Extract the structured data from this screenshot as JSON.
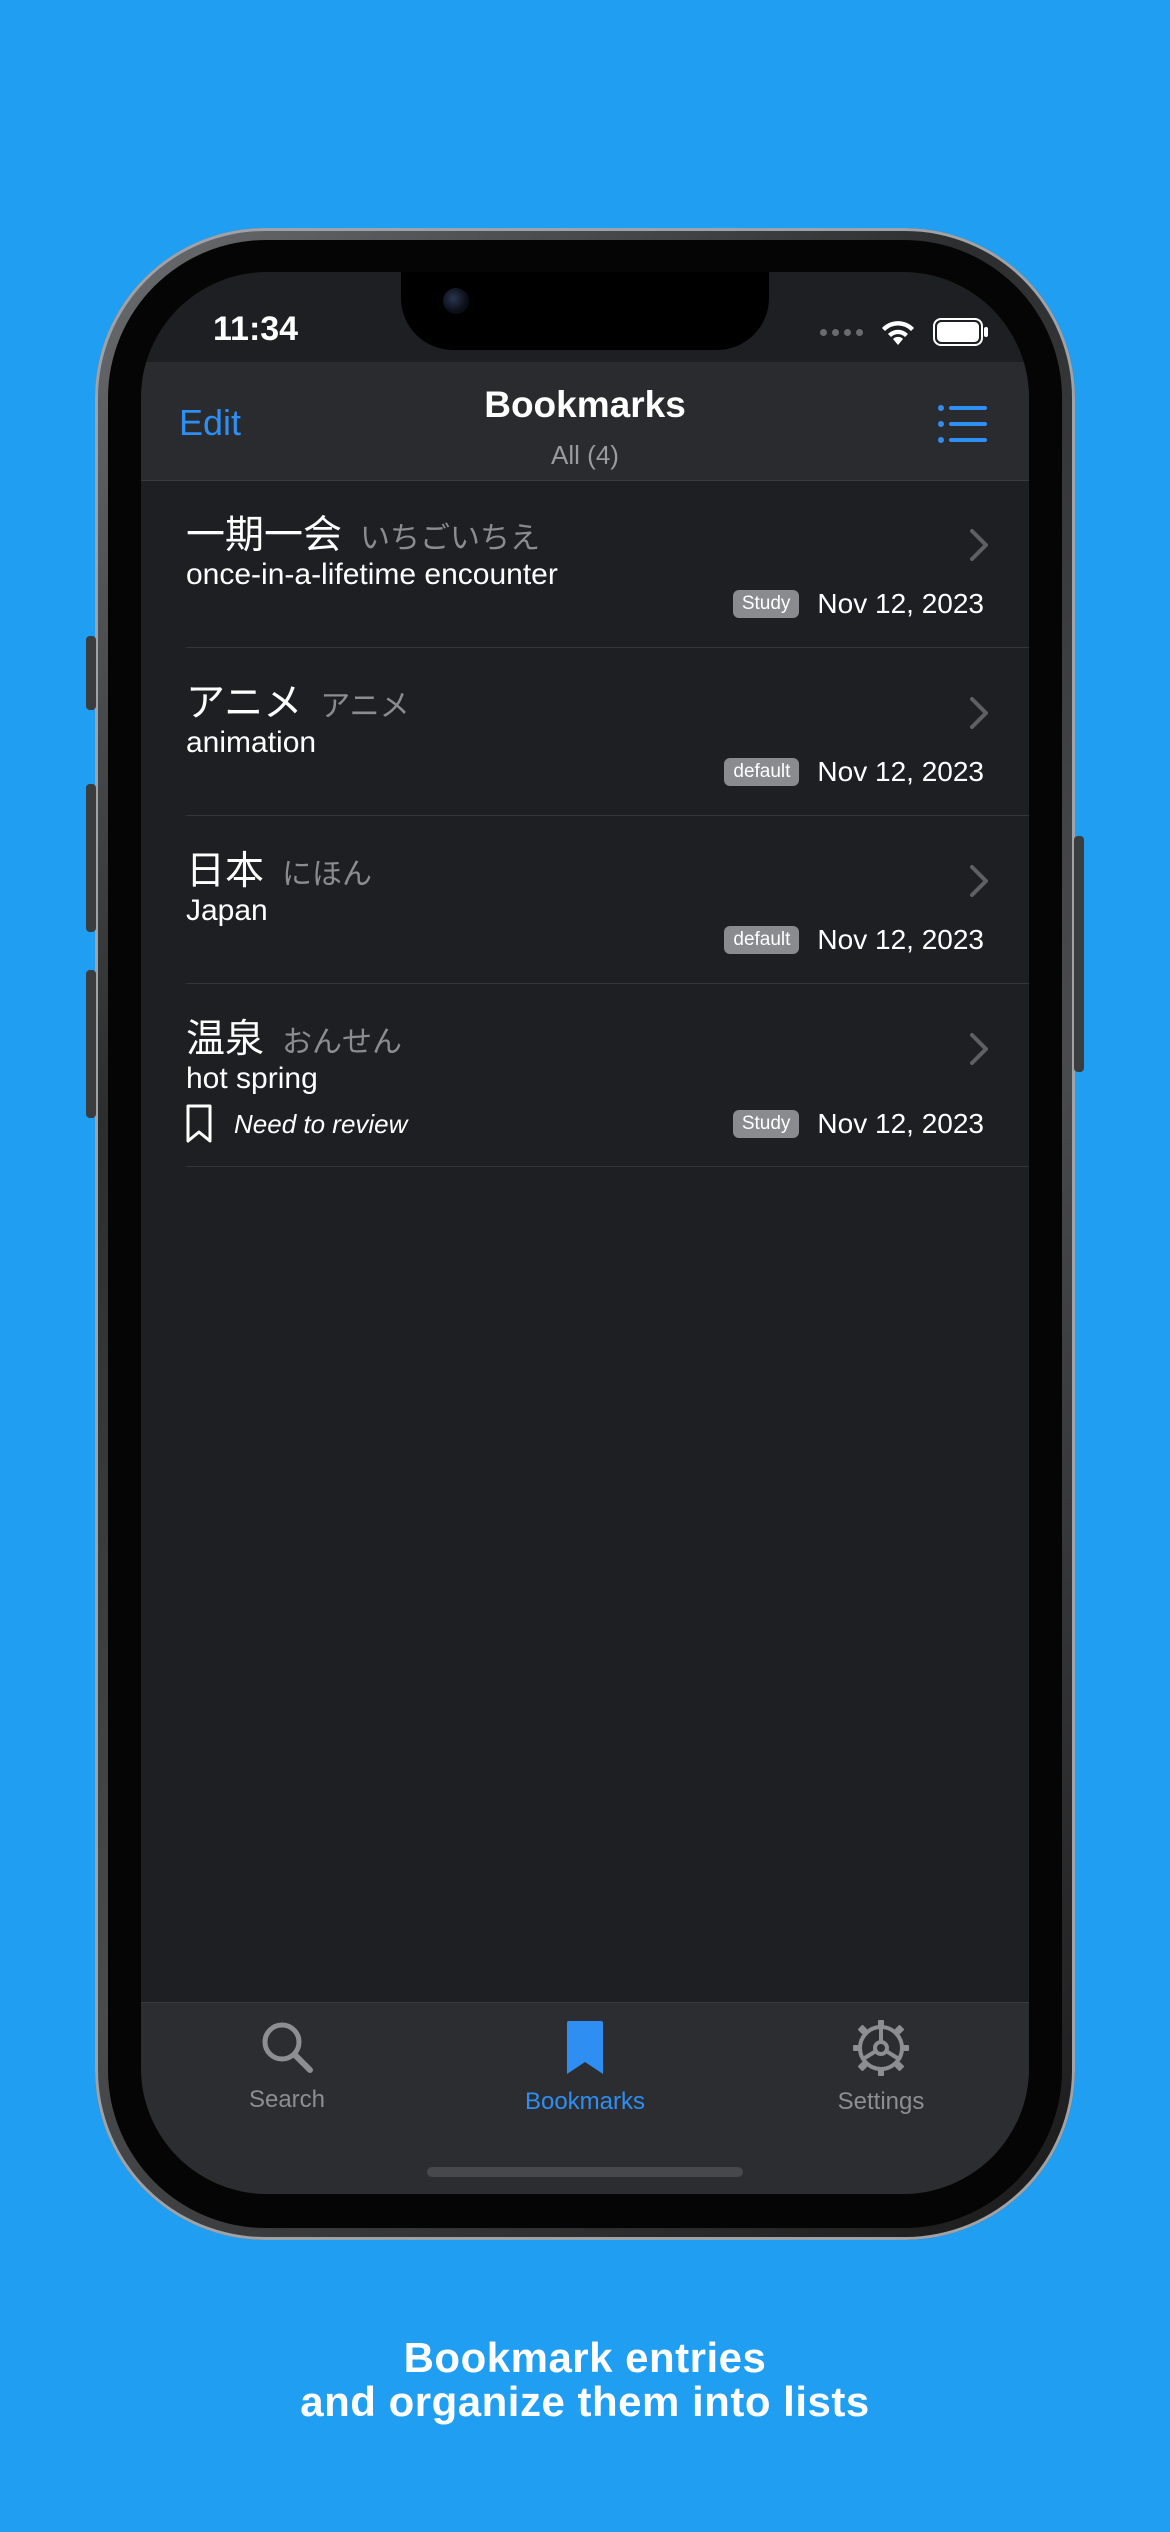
{
  "status": {
    "time": "11:34"
  },
  "nav": {
    "edit_label": "Edit",
    "title": "Bookmarks",
    "subtitle": "All (4)"
  },
  "entries": [
    {
      "word": "一期一会",
      "reading": "いちごいちえ",
      "meaning": "once-in-a-lifetime encounter",
      "list": "Study",
      "date": "Nov 12, 2023",
      "note": ""
    },
    {
      "word": "アニメ",
      "reading": "アニメ",
      "meaning": "animation",
      "list": "default",
      "date": "Nov 12, 2023",
      "note": ""
    },
    {
      "word": "日本",
      "reading": "にほん",
      "meaning": "Japan",
      "list": "default",
      "date": "Nov 12, 2023",
      "note": ""
    },
    {
      "word": "温泉",
      "reading": "おんせん",
      "meaning": "hot spring",
      "list": "Study",
      "date": "Nov 12, 2023",
      "note": "Need to review"
    }
  ],
  "tabs": [
    {
      "label": "Search",
      "icon": "search-icon",
      "active": false
    },
    {
      "label": "Bookmarks",
      "icon": "bookmark-icon",
      "active": true
    },
    {
      "label": "Settings",
      "icon": "gear-icon",
      "active": false
    }
  ],
  "caption": {
    "line1": "Bookmark entries",
    "line2": "and organize them into lists"
  },
  "colors": {
    "background": "#1f9ef2",
    "accent": "#2f8ef2",
    "screen": "#1e1f22"
  }
}
